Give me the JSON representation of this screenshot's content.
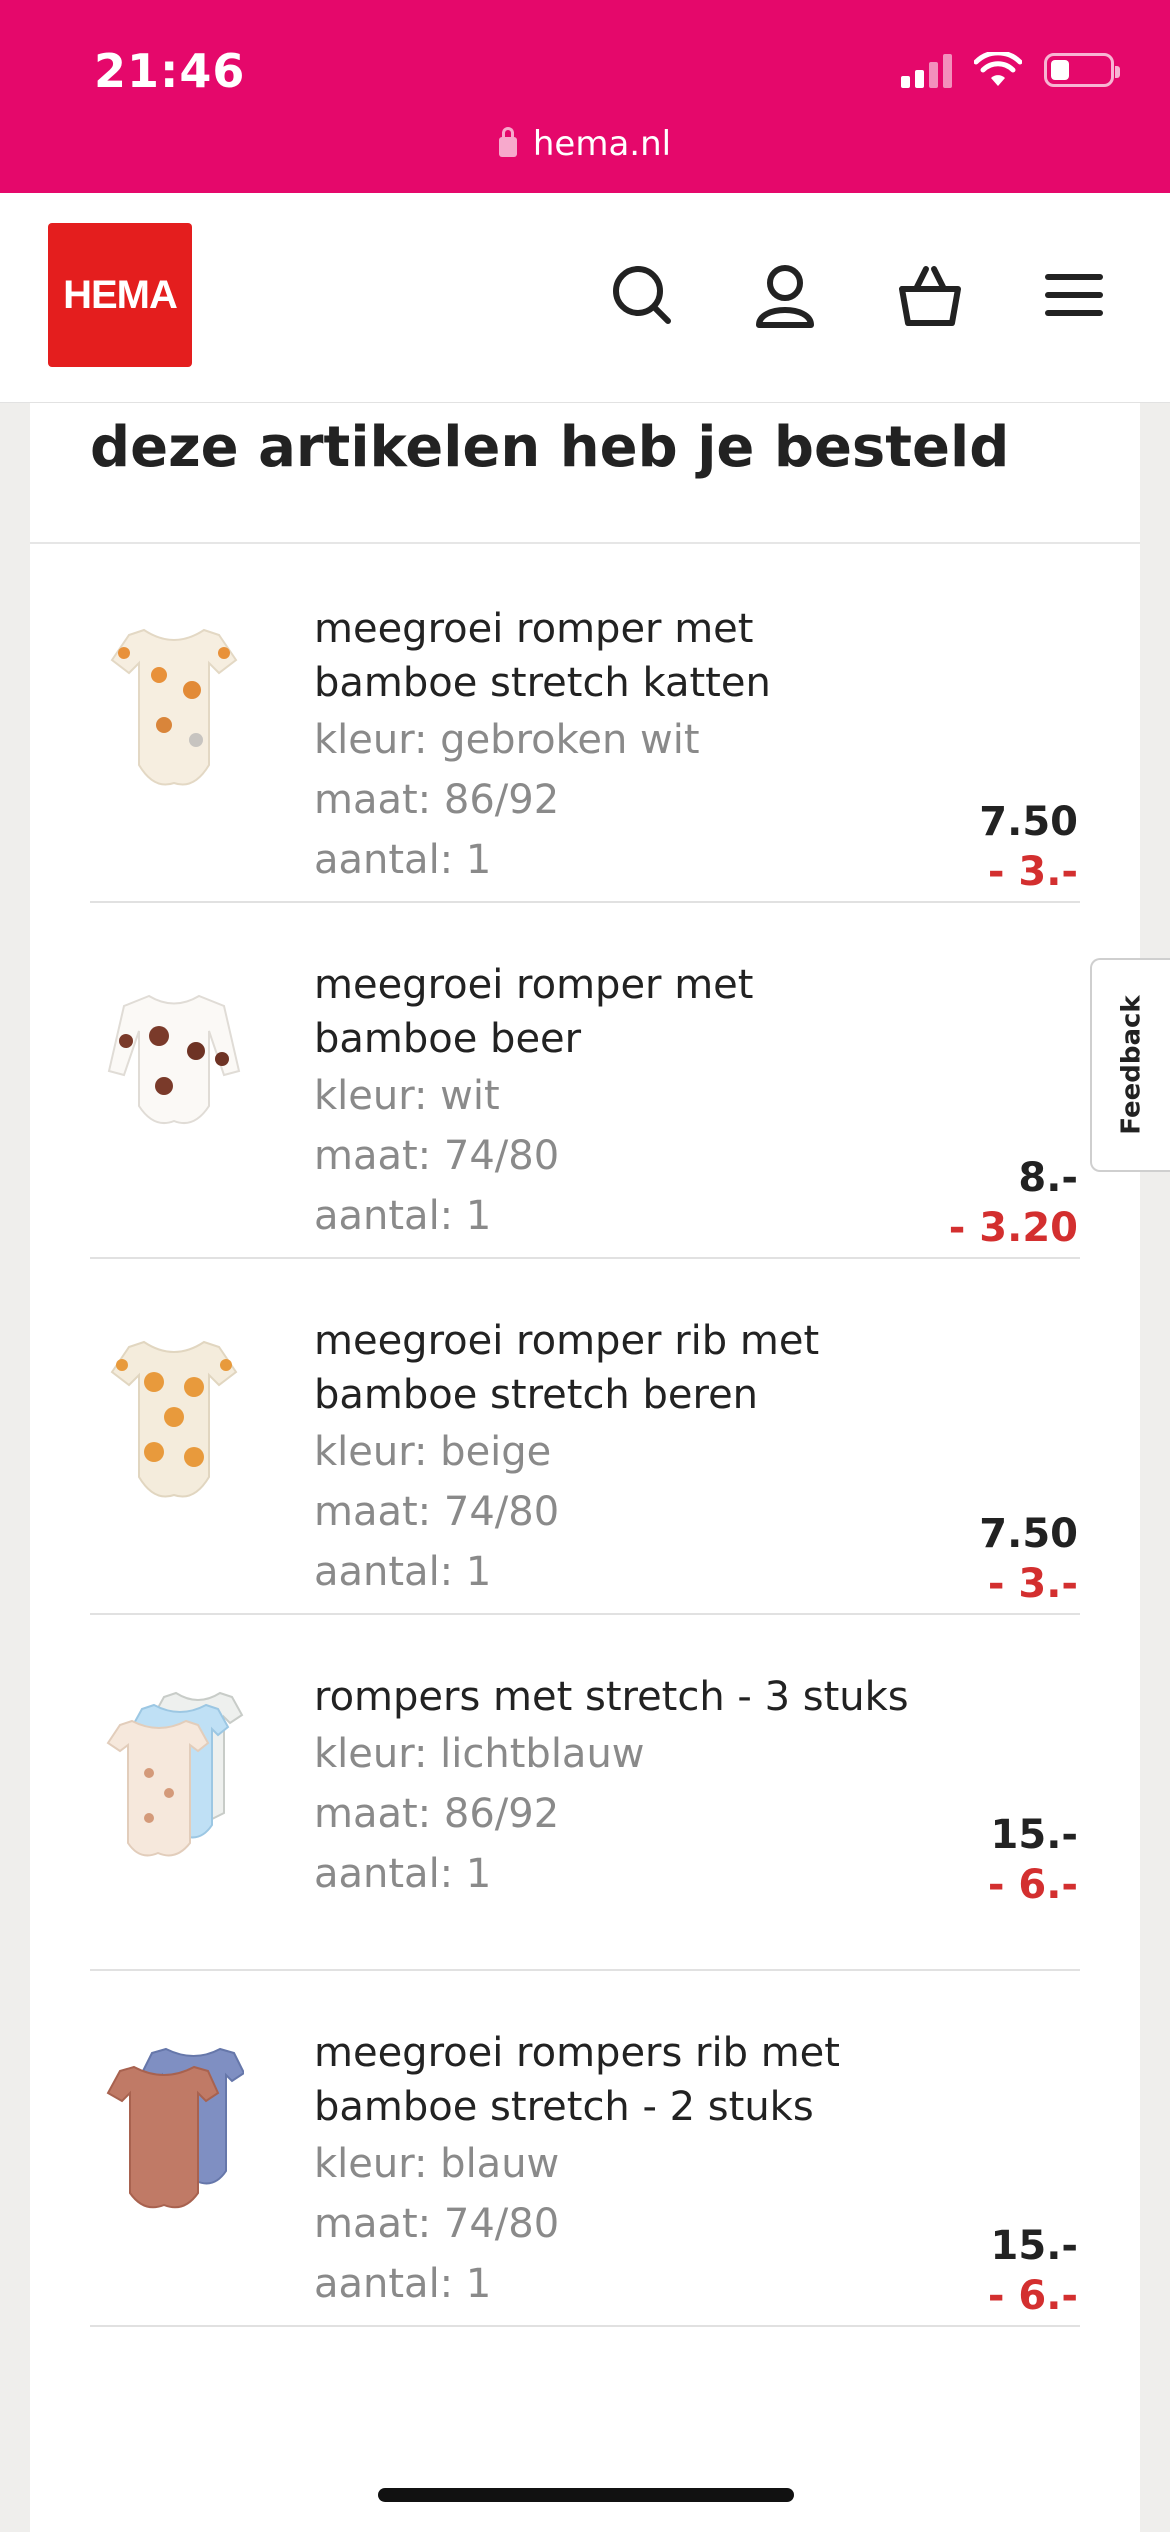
{
  "status_bar": {
    "time": "21:46",
    "url": "hema.nl",
    "icons": [
      "signal-icon",
      "wifi-icon",
      "battery-icon"
    ],
    "background": "#e5086b"
  },
  "header": {
    "logo_text": "HEMA",
    "logo_color": "#e41e1e",
    "icons": [
      "search-icon",
      "account-icon",
      "basket-icon",
      "menu-icon"
    ]
  },
  "section": {
    "title": "deze artikelen heb je besteld"
  },
  "items": [
    {
      "name": "meegroei romper met bamboe stretch katten",
      "color": "kleur: gebroken wit",
      "size": "maat: 86/92",
      "quantity": "aantal: 1",
      "price": "7.50",
      "discount": "- 3.-"
    },
    {
      "name": "meegroei romper met bamboe beer",
      "color": "kleur: wit",
      "size": "maat: 74/80",
      "quantity": "aantal: 1",
      "price": "8.-",
      "discount": "- 3.20"
    },
    {
      "name": "meegroei romper rib met bamboe stretch beren",
      "color": "kleur: beige",
      "size": "maat: 74/80",
      "quantity": "aantal: 1",
      "price": "7.50",
      "discount": "- 3.-"
    },
    {
      "name": "rompers met stretch - 3 stuks",
      "color": "kleur: lichtblauw",
      "size": "maat: 86/92",
      "quantity": "aantal: 1",
      "price": "15.-",
      "discount": "- 6.-"
    },
    {
      "name": "meegroei rompers rib met bamboe stretch - 2 stuks",
      "color": "kleur: blauw",
      "size": "maat: 74/80",
      "quantity": "aantal: 1",
      "price": "15.-",
      "discount": "- 6.-"
    }
  ],
  "feedback_tab": {
    "label": "Feedback"
  },
  "colors": {
    "accent": "#e5086b",
    "discount": "#d32f2f",
    "brand": "#e41e1e"
  }
}
